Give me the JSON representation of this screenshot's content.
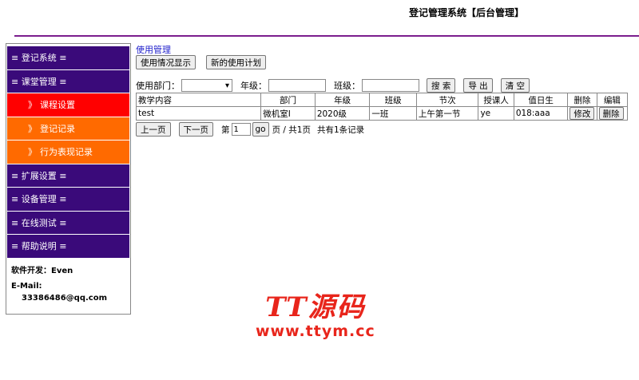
{
  "header": {
    "title": "登记管理系统【后台管理】"
  },
  "sidebar": {
    "items": [
      {
        "label": "≡ 登记系统 ≡"
      },
      {
        "label": "≡ 课堂管理 ≡"
      },
      {
        "label": "课程设置",
        "chev": "》"
      },
      {
        "label": "登记记录",
        "chev": "》"
      },
      {
        "label": "行为表现记录",
        "chev": "》"
      },
      {
        "label": "≡ 扩展设置 ≡"
      },
      {
        "label": "≡ 设备管理 ≡"
      },
      {
        "label": "≡ 在线测试 ≡"
      },
      {
        "label": "≡ 帮助说明 ≡"
      }
    ],
    "developer": "软件开发：Even",
    "email_label": "E-Mail:",
    "email": "33386486@qq.com"
  },
  "main": {
    "section_title": "使用管理",
    "buttons": {
      "usage_display": "使用情况显示",
      "new_plan": "新的使用计划"
    },
    "filters": {
      "dept_label": "使用部门：",
      "dept_value": "",
      "grade_label": "年级：",
      "grade_value": "",
      "class_label": "班级：",
      "class_value": "",
      "search": "搜 索",
      "export": "导 出",
      "clear": "清 空"
    },
    "table": {
      "headers": [
        "教学内容",
        "部门",
        "年级",
        "班级",
        "节次",
        "授课人",
        "值日生",
        "删除",
        "编辑"
      ],
      "rows": [
        {
          "content": "test",
          "dept": "微机室Ⅰ",
          "grade": "2020级",
          "class": "一班",
          "period": "上午第一节",
          "teacher": "ye",
          "duty": "018:aaa",
          "edit_btn": "修改",
          "delete_btn": "删除"
        }
      ]
    },
    "pager": {
      "prev": "上一页",
      "next": "下一页",
      "page_prefix": "第",
      "page_value": "1",
      "go": "go",
      "page_suffix": "页 / 共1页",
      "total": "共有1条记录"
    }
  },
  "watermark": {
    "logo": "TT源码",
    "url": "www.ttym.cc"
  },
  "colors": {
    "menu_group": "#3a0a7a",
    "menu_sub": "#ff6a00",
    "menu_active": "#ff0000",
    "header_line": "#7b1e8e",
    "section_title": "#2222cc",
    "watermark": "#e8251b"
  }
}
